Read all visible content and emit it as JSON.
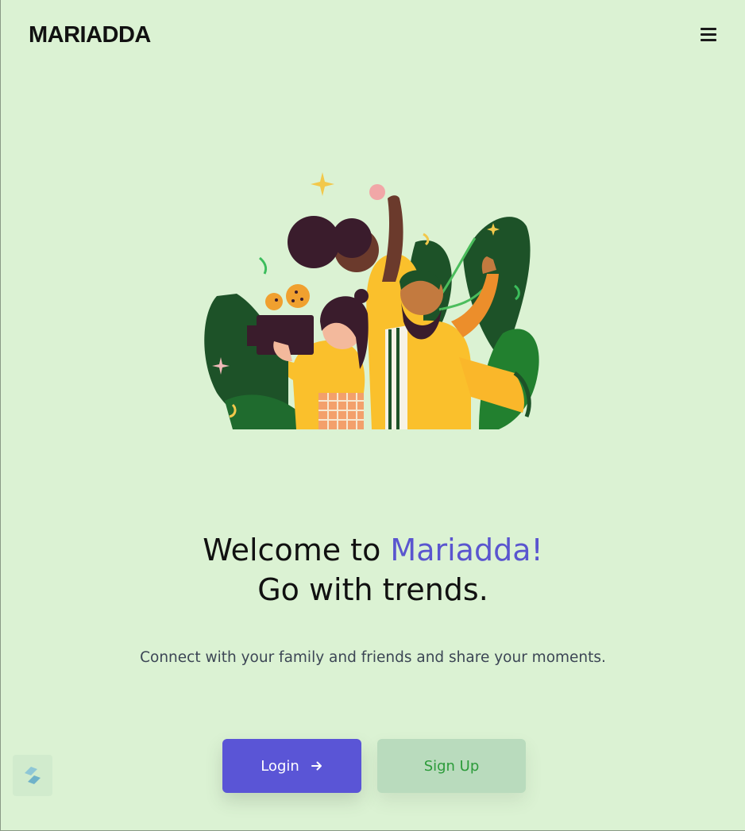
{
  "header": {
    "brand": "MARIADDA",
    "menu_icon": "hamburger-menu-icon"
  },
  "hero": {
    "welcome_prefix": "Welcome to ",
    "welcome_brand": "Mariadda!",
    "tagline": "Go with trends.",
    "subtitle": "Connect with your family and friends and share your moments."
  },
  "actions": {
    "login_label": "Login",
    "login_icon": "arrow-right-icon",
    "signup_label": "Sign Up"
  },
  "widget": {
    "icon": "stripe-s-logo-icon"
  },
  "colors": {
    "background": "#dbf2d3",
    "accent": "#5a55d6",
    "signup_bg": "#b9dbbd",
    "signup_text": "#2c9b3a"
  }
}
